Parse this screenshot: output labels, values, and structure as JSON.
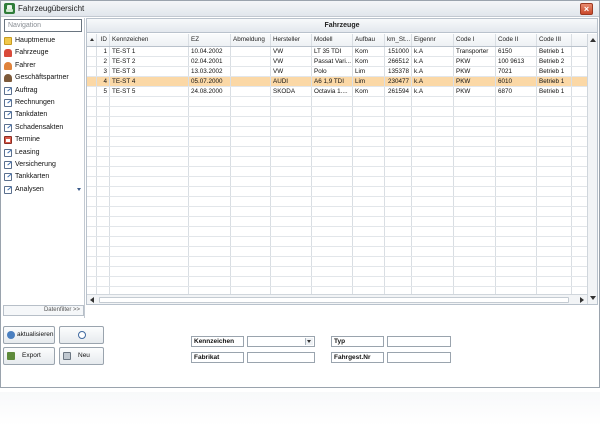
{
  "window": {
    "title": "Fahrzeugübersicht",
    "close_label": "×"
  },
  "navigation": {
    "header": "Navigation",
    "items": [
      {
        "label": "Hauptmenue",
        "icon": "folder-icon"
      },
      {
        "label": "Fahrzeuge",
        "icon": "car-icon"
      },
      {
        "label": "Fahrer",
        "icon": "driver-icon"
      },
      {
        "label": "Geschäftspartner",
        "icon": "partners-icon"
      },
      {
        "label": "Auftrag",
        "icon": "document-icon"
      },
      {
        "label": "Rechnungen",
        "icon": "document-icon"
      },
      {
        "label": "Tankdaten",
        "icon": "document-icon"
      },
      {
        "label": "Schadensakten",
        "icon": "document-icon"
      },
      {
        "label": "Termine",
        "icon": "calendar-icon"
      },
      {
        "label": "Leasing",
        "icon": "document-icon"
      },
      {
        "label": "Versicherung",
        "icon": "document-icon"
      },
      {
        "label": "Tankkarten",
        "icon": "document-icon"
      },
      {
        "label": "Analysen",
        "icon": "document-icon"
      }
    ],
    "datenfilter": "Datenfilter >>"
  },
  "grid": {
    "title": "Fahrzeuge",
    "columns": [
      "ID",
      "Kennzeichen",
      "EZ",
      "Abmeldung",
      "Hersteller",
      "Modell",
      "Aufbau",
      "km_St...",
      "Eigennr",
      "Code I",
      "Code II",
      "Code III"
    ],
    "rows": [
      [
        "1",
        "TE-ST 1",
        "10.04.2002",
        "",
        "VW",
        "LT 35 TDI",
        "Kom",
        "151000",
        "k.A",
        "Transporter",
        "6150",
        "Betrieb 1"
      ],
      [
        "2",
        "TE-ST 2",
        "02.04.2001",
        "",
        "VW",
        "Passat Vari...",
        "Kom",
        "266512",
        "k.A",
        "PKW",
        "100 9613",
        "Betrieb 2"
      ],
      [
        "3",
        "TE-ST 3",
        "13.03.2002",
        "",
        "VW",
        "Polo",
        "Lim",
        "135378",
        "k.A",
        "PKW",
        "7021",
        "Betrieb 1"
      ],
      [
        "4",
        "TE-ST 4",
        "05.07.2000",
        "",
        "AUDI",
        "A6 1,9 TDI",
        "Lim",
        "230477",
        "k.A",
        "PKW",
        "6010",
        "Betrieb 1"
      ],
      [
        "5",
        "TE-ST 5",
        "24.08.2000",
        "",
        "SKODA",
        "Octavia 1....",
        "Kom",
        "261594",
        "k.A",
        "PKW",
        "6870",
        "Betrieb 1"
      ]
    ],
    "selected_row": 3
  },
  "buttons": {
    "refresh": "aktualisieren",
    "export": "Export",
    "neu": "Neu"
  },
  "filters": {
    "kennzeichen": "Kennzeichen",
    "fabrikat": "Fabrikat",
    "typ": "Typ",
    "fahrgestnr": "Fahrgest.Nr"
  }
}
